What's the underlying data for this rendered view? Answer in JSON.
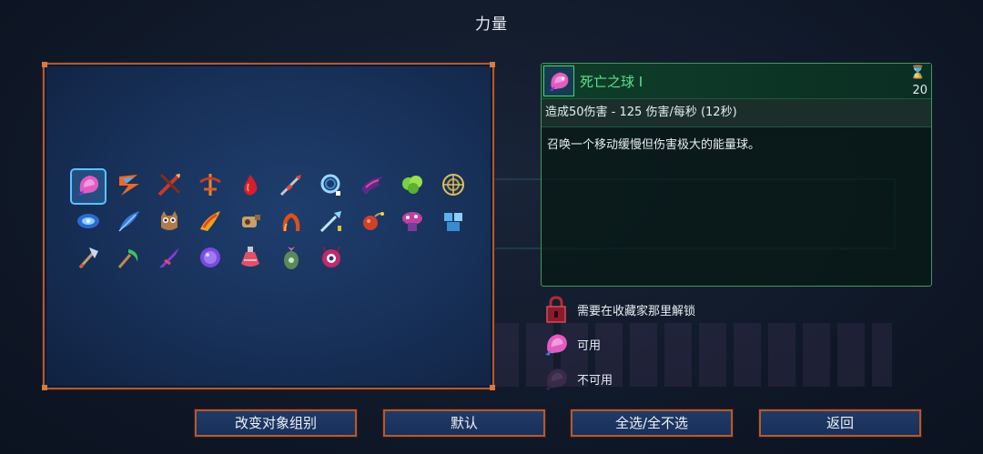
{
  "header": {
    "title": "力量"
  },
  "weapons": [
    {
      "icon": "death-orb-icon",
      "selected": true
    },
    {
      "icon": "lightning-blade-icon"
    },
    {
      "icon": "crossed-spears-icon"
    },
    {
      "icon": "fire-crossbow-icon"
    },
    {
      "icon": "blood-drop-icon"
    },
    {
      "icon": "spear-icon"
    },
    {
      "icon": "ice-ring-icon"
    },
    {
      "icon": "shadow-wing-icon"
    },
    {
      "icon": "poison-cloud-icon"
    },
    {
      "icon": "golden-shield-icon"
    },
    {
      "icon": "wave-disc-icon"
    },
    {
      "icon": "blue-feather-icon"
    },
    {
      "icon": "owl-icon"
    },
    {
      "icon": "fire-blade-icon"
    },
    {
      "icon": "whistle-icon"
    },
    {
      "icon": "fire-ring-icon"
    },
    {
      "icon": "ice-spear-icon"
    },
    {
      "icon": "bomb-icon"
    },
    {
      "icon": "mushroom-turret-icon"
    },
    {
      "icon": "ice-armor-icon"
    },
    {
      "icon": "axe-icon"
    },
    {
      "icon": "sickle-icon"
    },
    {
      "icon": "purple-dagger-icon"
    },
    {
      "icon": "purple-orb-icon"
    },
    {
      "icon": "potion-icon"
    },
    {
      "icon": "seed-pod-icon"
    },
    {
      "icon": "eye-creature-icon"
    }
  ],
  "detail": {
    "icon": "death-orb-icon",
    "name": "死亡之球 Ⅰ",
    "timer_icon": "hourglass-icon",
    "timer_value": "20",
    "stats": "造成50伤害 - 125 伤害/每秒 (12秒)",
    "description": "召唤一个移动缓慢但伤害极大的能量球。"
  },
  "legend": [
    {
      "icon": "lock-icon",
      "label": "需要在收藏家那里解锁"
    },
    {
      "icon": "available-orb-icon",
      "label": "可用"
    },
    {
      "icon": "unavailable-orb-icon",
      "label": "不可用"
    }
  ],
  "buttons": {
    "change_group": "改变对象组别",
    "default": "默认",
    "select_all": "全选/全不选",
    "back": "返回"
  },
  "colors": {
    "accent_orange": "#b05a34",
    "panel_blue": "#173058",
    "detail_green": "#5ee08a",
    "selected_cyan": "#5ec0ff"
  }
}
